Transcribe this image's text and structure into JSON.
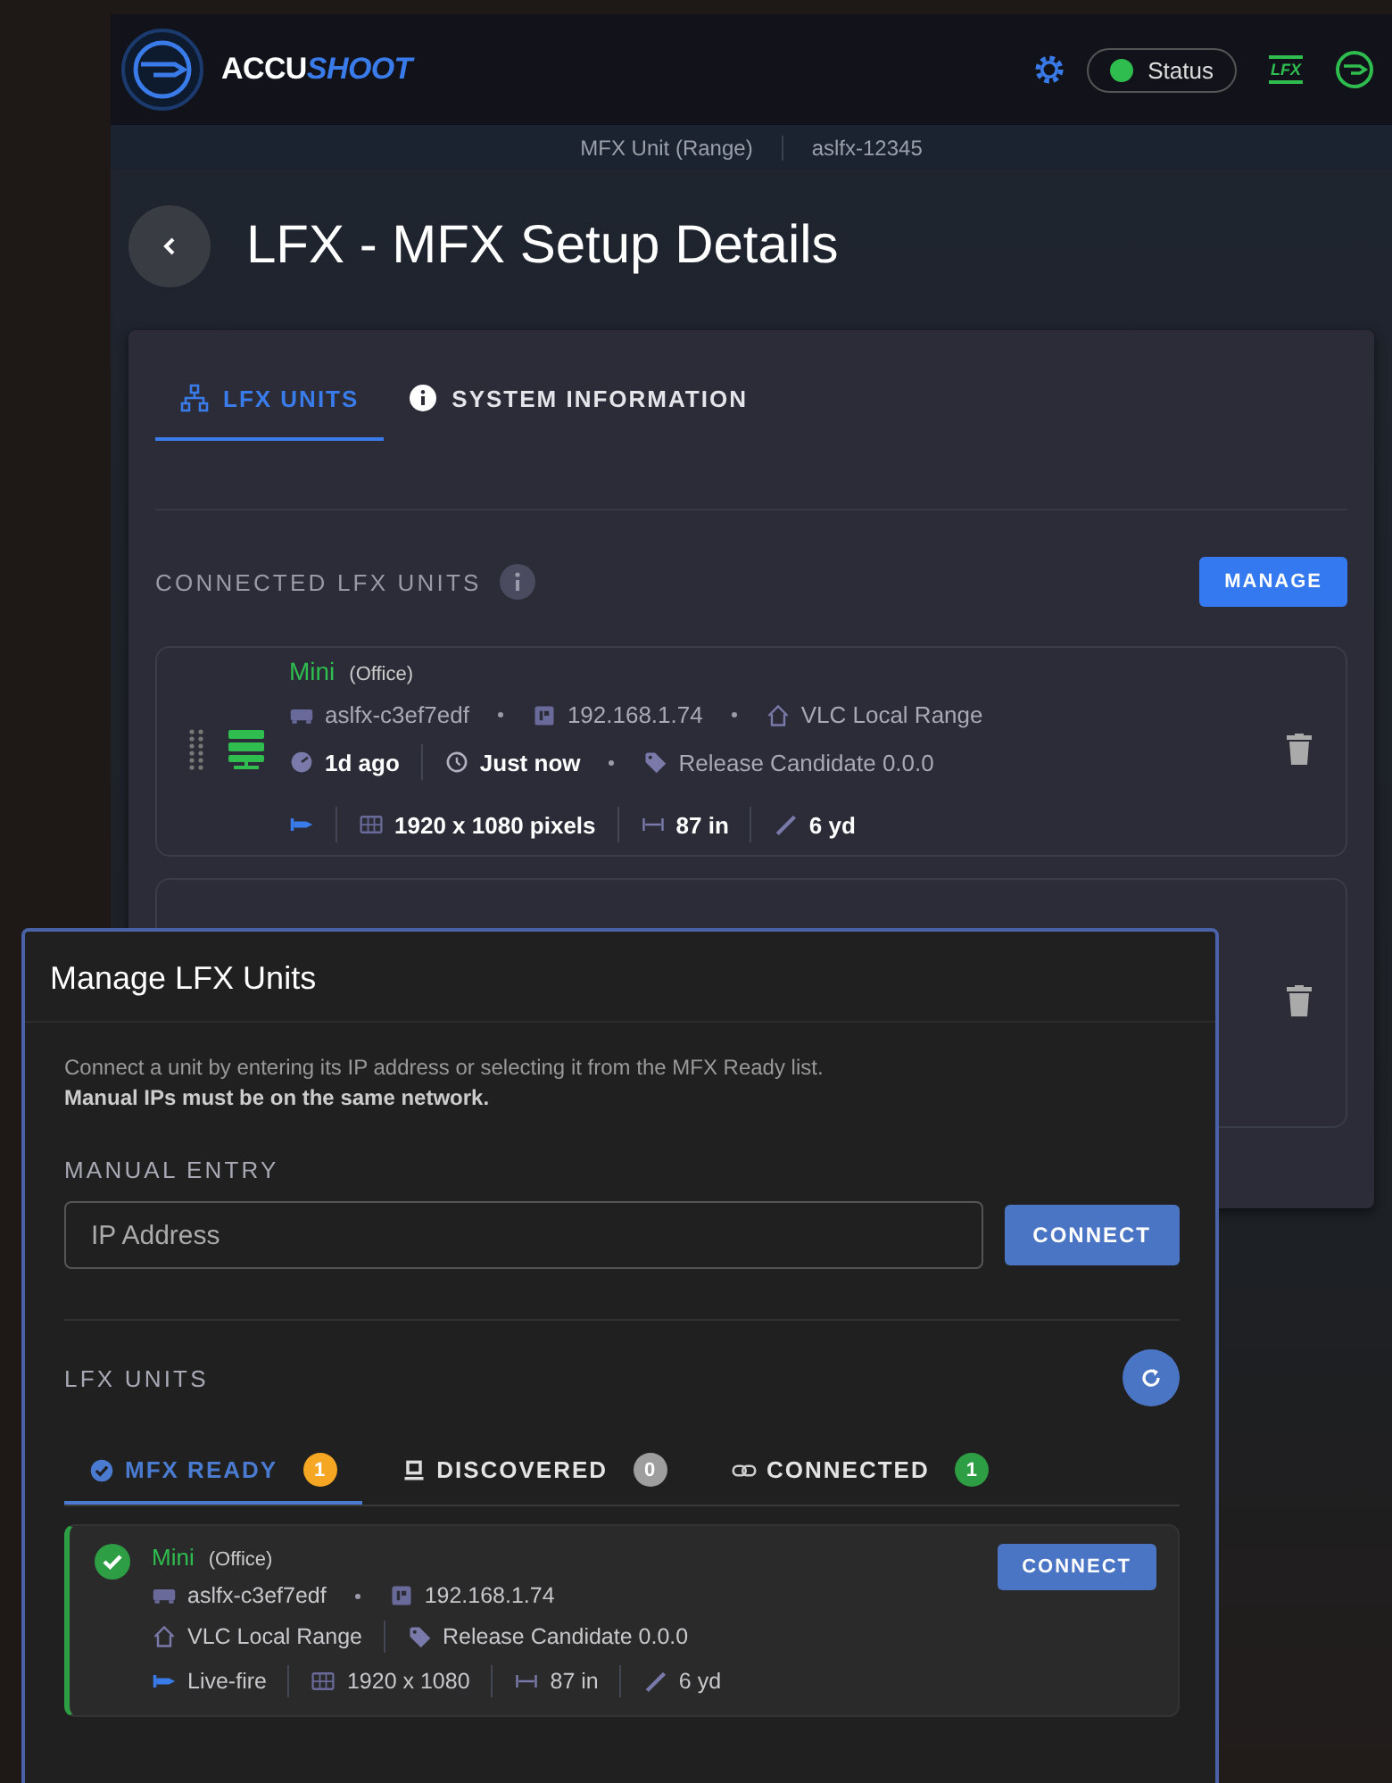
{
  "header": {
    "logo_text_a": "ACCU",
    "logo_text_b": "SHOOT",
    "status": {
      "label": "Status",
      "on": true
    },
    "lfx_badge": "LFX"
  },
  "subbar": {
    "unit": "MFX Unit (Range)",
    "serial": "aslfx-12345"
  },
  "page": {
    "title": "LFX - MFX Setup Details"
  },
  "tabs": [
    {
      "label": "LFX UNITS",
      "kind": "network",
      "selected": true
    },
    {
      "label": "SYSTEM INFORMATION",
      "kind": "info",
      "selected": false
    }
  ],
  "section": {
    "title": "CONNECTED LFX UNITS",
    "action": "MANAGE"
  },
  "units": [
    {
      "kind": "card",
      "name": "Mini",
      "location": "(Office)",
      "rows": [
        [
          {
            "kind": "serial",
            "text": "aslfx-c3ef7edf",
            "strong": false
          },
          {
            "kind": "dot"
          },
          {
            "kind": "ip",
            "text": "192.168.1.74",
            "strong": false
          },
          {
            "kind": "dot"
          },
          {
            "kind": "range",
            "text": "VLC Local Range",
            "strong": false
          }
        ],
        [
          {
            "kind": "uptime",
            "text": "1d ago",
            "strong": true
          },
          {
            "kind": "bar"
          },
          {
            "kind": "history",
            "text": "Just now",
            "strong": true
          },
          {
            "kind": "dot"
          },
          {
            "kind": "tag",
            "text": "Release Candidate 0.0.0",
            "strong": false
          }
        ],
        [
          {
            "kind": "blaster"
          },
          {
            "kind": "bar"
          },
          {
            "kind": "screen",
            "text": "1920 x 1080 pixels",
            "strong": true
          },
          {
            "kind": "bar"
          },
          {
            "kind": "width",
            "text": "87 in",
            "strong": true
          },
          {
            "kind": "bar"
          },
          {
            "kind": "distance",
            "text": "6 yd",
            "strong": true
          }
        ]
      ]
    },
    {
      "kind": "covered"
    }
  ],
  "dialog": {
    "title": "Manage LFX Units",
    "description": "Connect a unit by entering its IP address or selecting it from the MFX Ready list.",
    "note": "Manual IPs must be on the same network.",
    "manual_label": "MANUAL ENTRY",
    "ip_field": {
      "placeholder": "IP Address"
    },
    "connect": "CONNECT",
    "list_label": "LFX UNITS",
    "tabs": [
      {
        "label": "MFX READY",
        "kind": "check",
        "count": "1",
        "color": "#f5a623",
        "selected": true
      },
      {
        "label": "DISCOVERED",
        "kind": "monitor",
        "count": "0",
        "color": "#9e9e9e",
        "selected": false
      },
      {
        "label": "CONNECTED",
        "kind": "link",
        "count": "1",
        "color": "#2e9e44",
        "selected": false
      }
    ],
    "units": [
      {
        "name": "Mini",
        "location": "(Office)",
        "ready": true,
        "action": "CONNECT",
        "rows": [
          [
            {
              "kind": "serial",
              "text": "aslfx-c3ef7edf",
              "strong": false
            },
            {
              "kind": "dot"
            },
            {
              "kind": "ip",
              "text": "192.168.1.74",
              "strong": false
            }
          ],
          [
            {
              "kind": "range",
              "text": "VLC Local Range",
              "strong": false
            },
            {
              "kind": "bar"
            },
            {
              "kind": "tag",
              "text": "Release Candidate 0.0.0",
              "strong": false
            }
          ],
          [
            {
              "kind": "blaster",
              "text": "Live-fire",
              "strong": false
            },
            {
              "kind": "bar"
            },
            {
              "kind": "screen",
              "text": "1920 x 1080",
              "strong": false
            },
            {
              "kind": "bar"
            },
            {
              "kind": "width",
              "text": "87 in",
              "strong": false
            },
            {
              "kind": "bar"
            },
            {
              "kind": "distance",
              "text": "6 yd",
              "strong": false
            }
          ]
        ]
      }
    ]
  }
}
